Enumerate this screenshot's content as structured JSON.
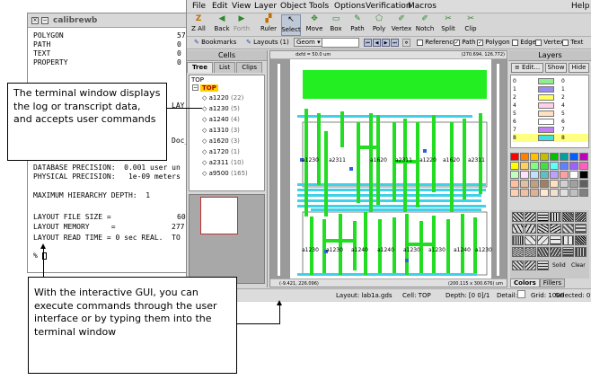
{
  "terminal": {
    "title": "calibrewb",
    "lines": [
      "POLYGON",
      "PATH",
      "TEXT",
      "PROPERTY",
      "DATABASE PRECISION:  0.001 user un",
      "PHYSICAL PRECISION:   1e-09 meters",
      "MAXIMUM HIERARCHY DEPTH:  1",
      "LAYOUT FILE SIZE =",
      "LAYOUT MEMORY     =",
      "LAYOUT READ TIME = 0 sec REAL.  TO",
      "%"
    ],
    "values": [
      "57",
      "0",
      "0",
      "0",
      "60",
      "277"
    ],
    "partial": [
      "LAY",
      "Doc_"
    ]
  },
  "callouts": {
    "terminal": "The terminal window displays the log or transcript data, and accepts user commands",
    "gui": "With the interactive GUI, you can execute commands through the user interface or by typing them into the terminal window"
  },
  "menubar": {
    "items": [
      "File",
      "Edit",
      "View",
      "Layer",
      "Object",
      "Tools",
      "Options",
      "Verification",
      "Macros"
    ],
    "help": "Help"
  },
  "toolbar": {
    "tools": [
      {
        "label": "Z All",
        "icon": "zoom-all-icon",
        "glyph": "Z"
      },
      {
        "label": "Back",
        "icon": "back-icon",
        "glyph": "◀"
      },
      {
        "label": "Forth",
        "icon": "forth-icon",
        "glyph": "▶"
      },
      {
        "label": "Ruler",
        "icon": "ruler-icon",
        "glyph": "▞"
      },
      {
        "label": "Select",
        "icon": "select-icon",
        "glyph": "↖"
      },
      {
        "label": "Move",
        "icon": "move-icon",
        "glyph": "✥"
      },
      {
        "label": "Box",
        "icon": "box-icon",
        "glyph": "▭"
      },
      {
        "label": "Path",
        "icon": "path-icon",
        "glyph": "✎"
      },
      {
        "label": "Poly",
        "icon": "poly-icon",
        "glyph": "⬠"
      },
      {
        "label": "Vertex",
        "icon": "vertex-icon",
        "glyph": "✐"
      },
      {
        "label": "Notch",
        "icon": "notch-icon",
        "glyph": "✐"
      },
      {
        "label": "Split",
        "icon": "split-icon",
        "glyph": "✂"
      },
      {
        "label": "Clip",
        "icon": "clip-icon",
        "glyph": "✂"
      }
    ]
  },
  "optbar": {
    "bookmarks": "Bookmarks",
    "layouts": "Layouts (1)",
    "geom": "Geom",
    "checks": [
      {
        "label": "Reference",
        "checked": false
      },
      {
        "label": "Path",
        "checked": true
      },
      {
        "label": "Polygon",
        "checked": true
      },
      {
        "label": "Edge",
        "checked": false
      },
      {
        "label": "Vertex",
        "checked": false
      },
      {
        "label": "Text",
        "checked": false
      }
    ]
  },
  "cells": {
    "title": "Cells",
    "tabs": [
      "Tree",
      "List",
      "Clips"
    ],
    "root_label": "TOP",
    "top": "TOP",
    "items": [
      {
        "name": "a1220",
        "count": "(22)"
      },
      {
        "name": "a1230",
        "count": "(5)"
      },
      {
        "name": "a1240",
        "count": "(4)"
      },
      {
        "name": "a1310",
        "count": "(3)"
      },
      {
        "name": "a1620",
        "count": "(3)"
      },
      {
        "name": "a1720",
        "count": "(1)"
      },
      {
        "name": "a2311",
        "count": "(10)"
      },
      {
        "name": "a9500",
        "count": "(165)"
      }
    ]
  },
  "canvas": {
    "top_left": "dxfd = 50.0 um",
    "top_right": "(270.694, 126.772)",
    "bottom_left": "(-9.421, 226.096)",
    "bottom_right": "(200.115 x 300.676) um",
    "cell_labels_upper": [
      "a1230",
      "a2311",
      "a1620",
      "a2311",
      "a1220",
      "a1620",
      "a2311"
    ],
    "cell_labels_lower": [
      "a1230",
      "a1230",
      "a1240",
      "a1240",
      "a1230",
      "a1230",
      "a1240",
      "a1230"
    ]
  },
  "layers": {
    "title": "Layers",
    "buttons": [
      "Edit...",
      "Show",
      "Hide"
    ],
    "rows": [
      {
        "num": "0",
        "color": "#90ee90",
        "n2": "0"
      },
      {
        "num": "1",
        "color": "#9a8cf0",
        "n2": "1"
      },
      {
        "num": "2",
        "color": "#ffff60",
        "n2": "2"
      },
      {
        "num": "4",
        "color": "#ffd0e8",
        "n2": "4"
      },
      {
        "num": "5",
        "color": "#ffe0c0",
        "n2": "5"
      },
      {
        "num": "6",
        "color": "#ffffff",
        "n2": "6"
      },
      {
        "num": "7",
        "color": "#c080f0",
        "n2": "7"
      },
      {
        "num": "8",
        "color": "#40e0e0",
        "n2": "8"
      }
    ],
    "pattern_buttons": [
      "Solid",
      "Clear"
    ],
    "bottom_tabs": [
      "Colors",
      "Fillers"
    ]
  },
  "status": {
    "layout": "Layout: lab1a.gds",
    "cell": "Cell: TOP",
    "depth": "Depth: [0 0]/1",
    "detail": "Detail:",
    "grid": "Grid: 1000",
    "selected": "Selected: 0"
  }
}
